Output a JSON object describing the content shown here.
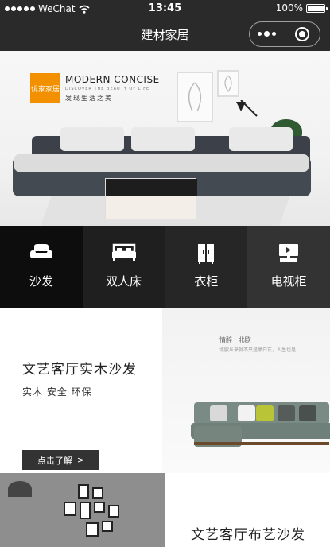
{
  "status_bar": {
    "carrier": "WeChat",
    "time": "13:45",
    "battery": "100%",
    "battery_level": 1.0
  },
  "nav": {
    "title": "建材家居"
  },
  "banner": {
    "brand_logo_text": "优家家居",
    "headline": "MODERN CONCISE",
    "subline": "DISCOVER THE BEAUTY OF LIFE",
    "slogan": "发现生活之美"
  },
  "categories": [
    {
      "label": "沙发",
      "icon": "sofa-icon",
      "bg": "#0d0d0d"
    },
    {
      "label": "双人床",
      "icon": "bed-icon",
      "bg": "#1f1f1f"
    },
    {
      "label": "衣柜",
      "icon": "wardrobe-icon",
      "bg": "#262626"
    },
    {
      "label": "电视柜",
      "icon": "tv-cabinet-icon",
      "bg": "#333333"
    }
  ],
  "promo1": {
    "title": "文艺客厅实木沙发",
    "tags": "实木  安全  环保",
    "button_label": "点击了解",
    "image_caption": "情醉 · 北欧",
    "image_subcaption": "北欧从来就不只是黑白灰，人生也是……"
  },
  "promo2": {
    "title": "文艺客厅布艺沙发"
  }
}
